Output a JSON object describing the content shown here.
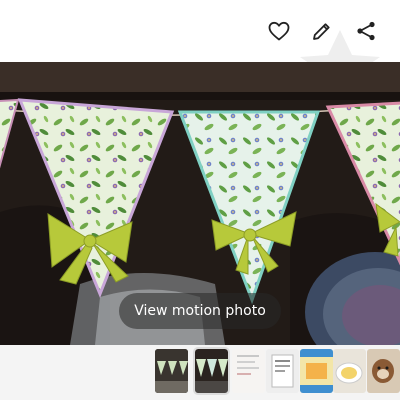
{
  "toolbar": {
    "actions": [
      {
        "name": "favorite",
        "icon": "heart-outline-icon"
      },
      {
        "name": "edit",
        "icon": "pencil-icon"
      },
      {
        "name": "share",
        "icon": "share-icon"
      }
    ]
  },
  "viewer": {
    "motion_photo_label": "View motion photo",
    "image": "decorative-bunting-banner"
  },
  "filmstrip": {
    "thumbnails": [
      {
        "content": "dark-bunting-photo"
      },
      {
        "content": "bunting-photo-selected"
      },
      {
        "content": "paper-document"
      },
      {
        "content": "printed-card"
      },
      {
        "content": "colorful-card"
      },
      {
        "content": "bowl-photo"
      },
      {
        "content": "dog-photo"
      }
    ]
  },
  "colors": {
    "icon": "#222222",
    "leaf_green": "#6fa84a",
    "ribbon": "#b7c93a",
    "flower_purple": "#8c6ab0"
  }
}
